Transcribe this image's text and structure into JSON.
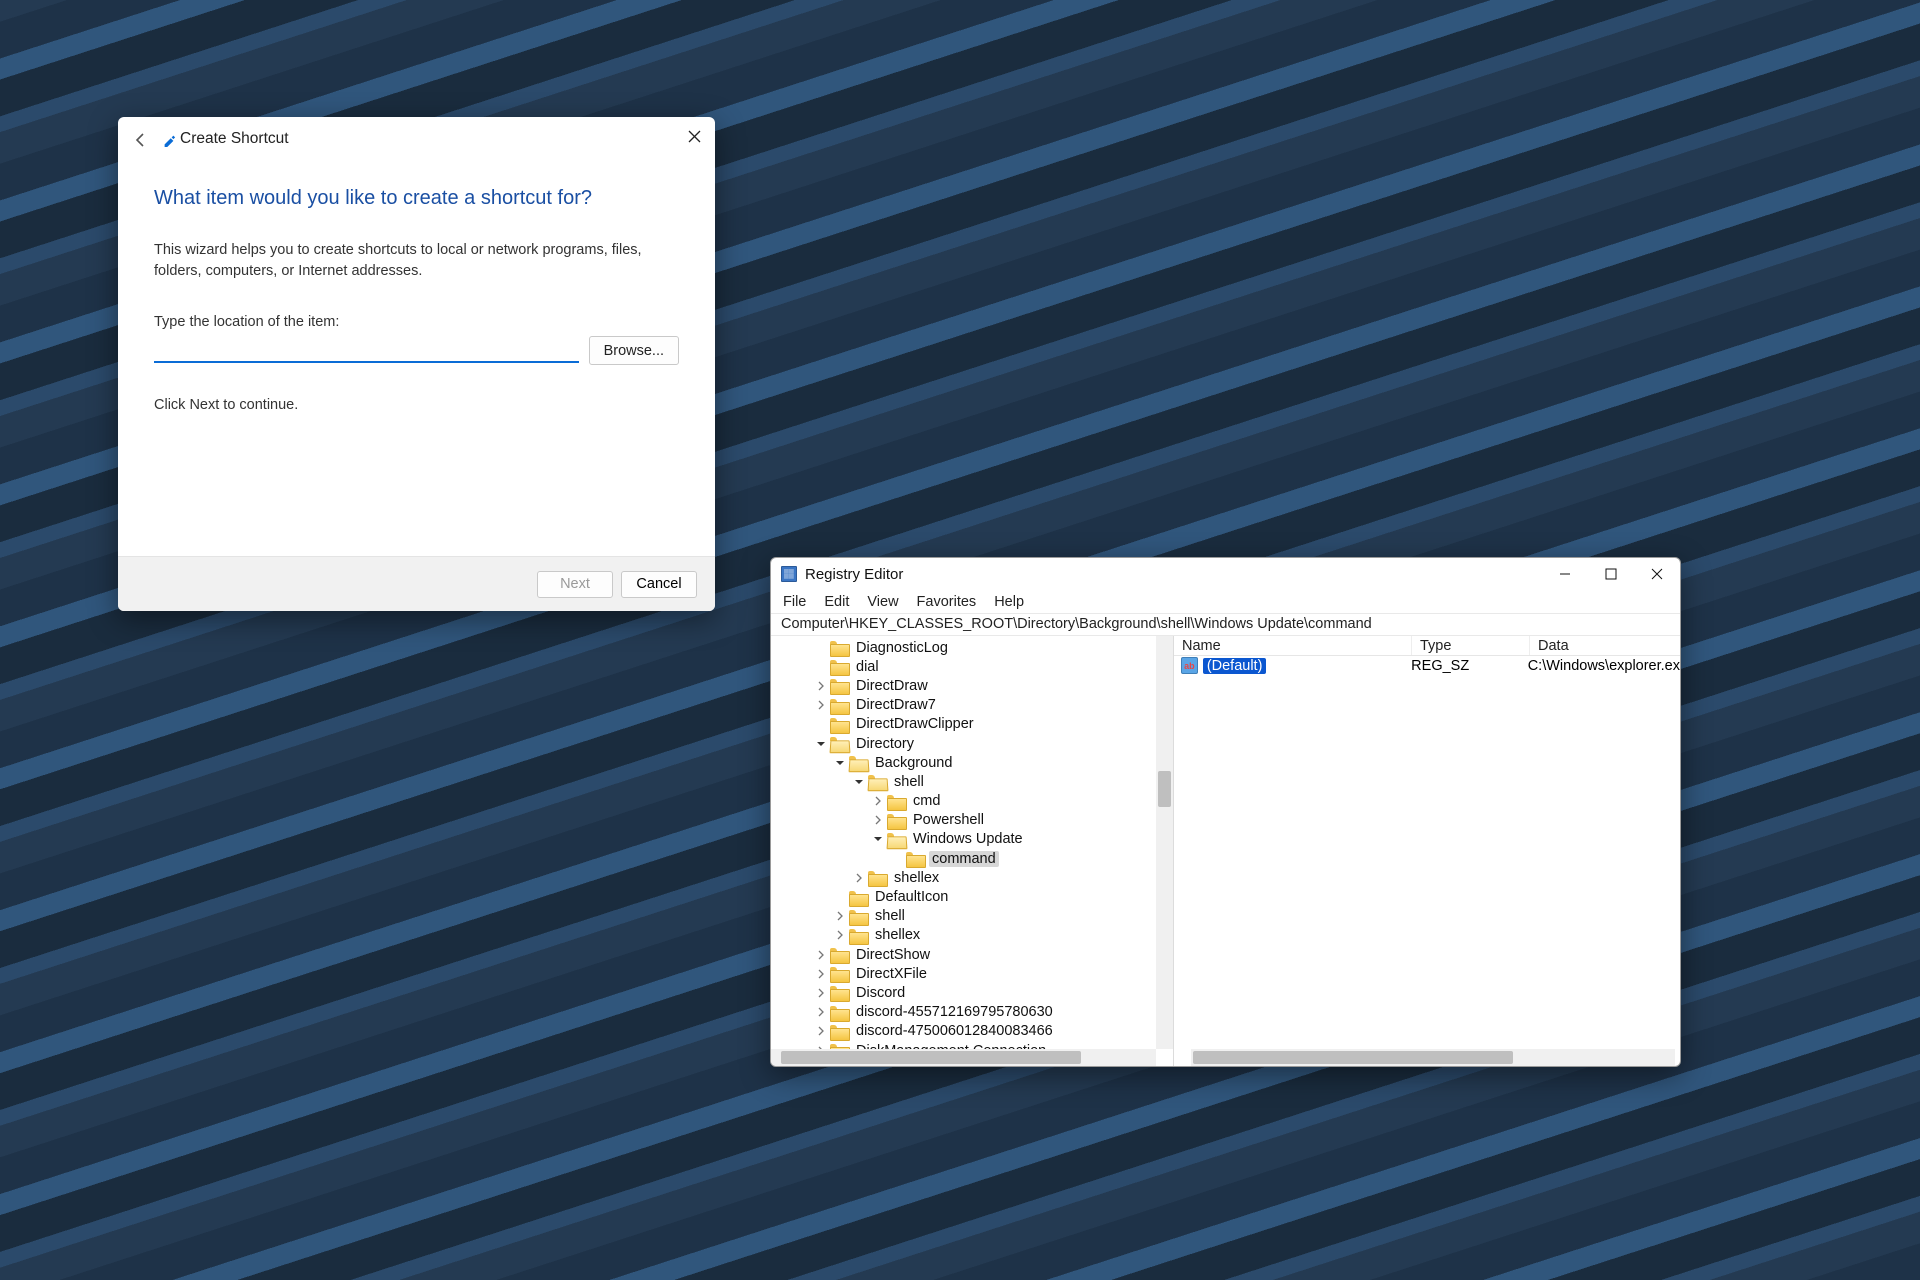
{
  "shortcut": {
    "title": "Create Shortcut",
    "heading": "What item would you like to create a shortcut for?",
    "description": "This wizard helps you to create shortcuts to local or network programs, files, folders, computers, or Internet addresses.",
    "input_label": "Type the location of the item:",
    "input_value": "",
    "browse_label": "Browse...",
    "continue_text": "Click Next to continue.",
    "next_label": "Next",
    "cancel_label": "Cancel"
  },
  "regedit": {
    "title": "Registry Editor",
    "menu": [
      "File",
      "Edit",
      "View",
      "Favorites",
      "Help"
    ],
    "address": "Computer\\HKEY_CLASSES_ROOT\\Directory\\Background\\shell\\Windows Update\\command",
    "tree": [
      {
        "depth": 2,
        "exp": "none",
        "open": false,
        "label": "DiagnosticLog"
      },
      {
        "depth": 2,
        "exp": "none",
        "open": false,
        "label": "dial"
      },
      {
        "depth": 2,
        "exp": "closed",
        "open": false,
        "label": "DirectDraw"
      },
      {
        "depth": 2,
        "exp": "closed",
        "open": false,
        "label": "DirectDraw7"
      },
      {
        "depth": 2,
        "exp": "none",
        "open": false,
        "label": "DirectDrawClipper"
      },
      {
        "depth": 2,
        "exp": "open",
        "open": true,
        "label": "Directory"
      },
      {
        "depth": 3,
        "exp": "open",
        "open": true,
        "label": "Background"
      },
      {
        "depth": 4,
        "exp": "open",
        "open": true,
        "label": "shell"
      },
      {
        "depth": 5,
        "exp": "closed",
        "open": false,
        "label": "cmd"
      },
      {
        "depth": 5,
        "exp": "closed",
        "open": false,
        "label": "Powershell"
      },
      {
        "depth": 5,
        "exp": "open",
        "open": true,
        "label": "Windows Update"
      },
      {
        "depth": 6,
        "exp": "none",
        "open": false,
        "label": "command",
        "selected": true
      },
      {
        "depth": 4,
        "exp": "closed",
        "open": false,
        "label": "shellex"
      },
      {
        "depth": 3,
        "exp": "none",
        "open": false,
        "label": "DefaultIcon"
      },
      {
        "depth": 3,
        "exp": "closed",
        "open": false,
        "label": "shell"
      },
      {
        "depth": 3,
        "exp": "closed",
        "open": false,
        "label": "shellex"
      },
      {
        "depth": 2,
        "exp": "closed",
        "open": false,
        "label": "DirectShow"
      },
      {
        "depth": 2,
        "exp": "closed",
        "open": false,
        "label": "DirectXFile"
      },
      {
        "depth": 2,
        "exp": "closed",
        "open": false,
        "label": "Discord"
      },
      {
        "depth": 2,
        "exp": "closed",
        "open": false,
        "label": "discord-455712169795780630"
      },
      {
        "depth": 2,
        "exp": "closed",
        "open": false,
        "label": "discord-475006012840083466"
      },
      {
        "depth": 2,
        "exp": "closed",
        "open": false,
        "label": "DiskManagement.Connection"
      }
    ],
    "columns": {
      "name": "Name",
      "type": "Type",
      "data": "Data"
    },
    "values": [
      {
        "name": "(Default)",
        "type": "REG_SZ",
        "data": "C:\\Windows\\explorer.ex"
      }
    ]
  }
}
